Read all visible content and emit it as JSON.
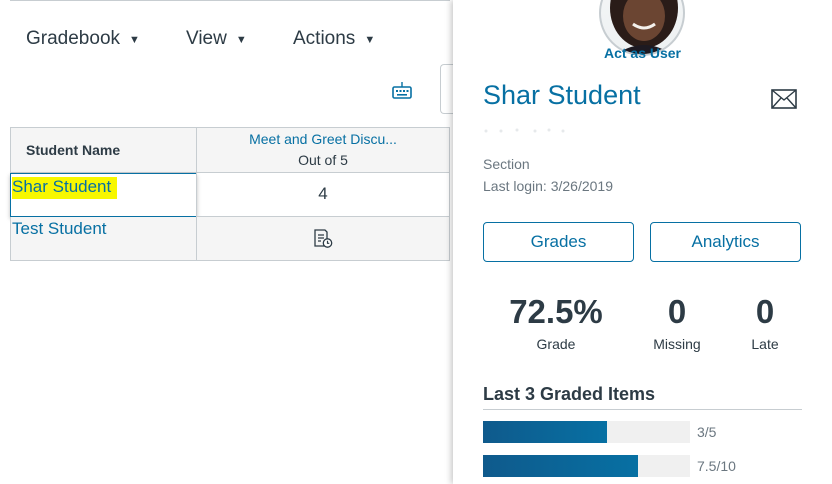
{
  "toolbar": {
    "menus": [
      {
        "label": "Gradebook"
      },
      {
        "label": "View"
      },
      {
        "label": "Actions"
      }
    ]
  },
  "grid": {
    "header": {
      "student_name": "Student Name",
      "assignment_title": "Meet and Greet Discu...",
      "assignment_points": "Out of 5"
    },
    "rows": [
      {
        "student": "Shar Student",
        "score": "4"
      },
      {
        "student": "Test Student",
        "score": ""
      }
    ]
  },
  "tray": {
    "act_as": "Act as User",
    "student_name": "Shar Student",
    "section_label": "Section",
    "last_login": "Last login: 3/26/2019",
    "buttons": {
      "grades": "Grades",
      "analytics": "Analytics"
    },
    "stats": [
      {
        "value": "72.5%",
        "label": "Grade"
      },
      {
        "value": "0",
        "label": "Missing"
      },
      {
        "value": "0",
        "label": "Late"
      }
    ],
    "graded_title": "Last 3 Graded Items",
    "graded_items": [
      {
        "score": "3/5",
        "fraction": 0.6
      },
      {
        "score": "7.5/10",
        "fraction": 0.75
      }
    ]
  },
  "icons": {
    "keyboard": "keyboard-icon",
    "submission": "submission-pending-icon",
    "mail": "mail-icon",
    "menu_caret": "caret-down-icon"
  },
  "colors": {
    "link": "#0770a3",
    "text": "#2d3b45",
    "muted": "#6b7780",
    "highlight": "#f7f700",
    "bar": "#0770a3",
    "track": "#f0f0f0"
  }
}
